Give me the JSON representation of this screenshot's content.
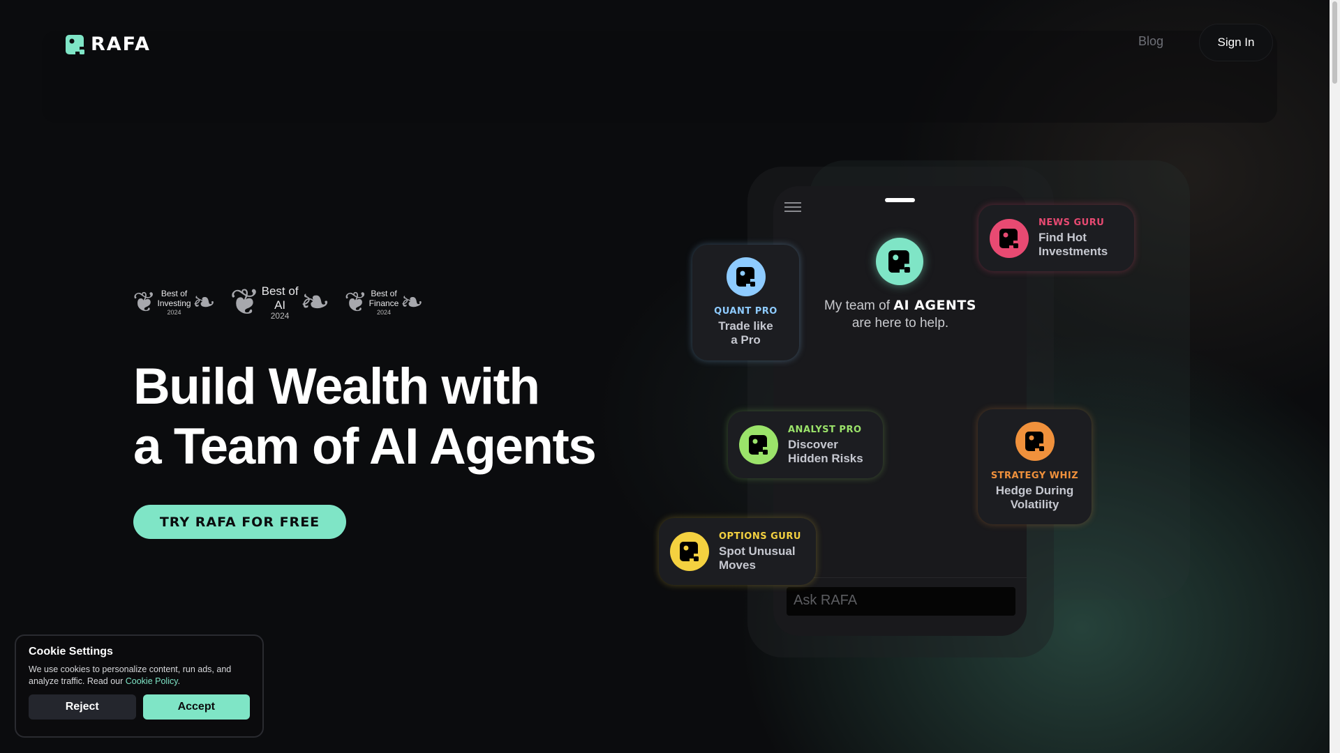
{
  "nav": {
    "brand": "RAFA",
    "blog": "Blog",
    "sign_in": "Sign In"
  },
  "colors": {
    "accent": "#7fe5c6",
    "background": "#0b0c0e"
  },
  "badges": [
    {
      "line1": "Best of",
      "line2": "Investing",
      "year": "2024"
    },
    {
      "line1": "Best of",
      "line2": "AI",
      "year": "2024"
    },
    {
      "line1": "Best of",
      "line2": "Finance",
      "year": "2024"
    }
  ],
  "hero": {
    "line1": "Build Wealth with",
    "line2": "a Team of AI Agents",
    "cta": "TRY RAFA FOR FREE"
  },
  "phone": {
    "intro_prefix": "My team of",
    "intro_bold": "AI AGENTS",
    "intro_suffix": "are here to help.",
    "ask_placeholder": "Ask RAFA"
  },
  "agents": [
    {
      "name": "QUANT PRO",
      "line1": "Trade like",
      "line2": "a Pro",
      "color": "#8ecbff"
    },
    {
      "name": "NEWS GURU",
      "line1": "Find Hot",
      "line2": "Investments",
      "color": "#e84a72"
    },
    {
      "name": "ANALYST PRO",
      "line1": "Discover",
      "line2": "Hidden Risks",
      "color": "#9be36a"
    },
    {
      "name": "STRATEGY WHIZ",
      "line1": "Hedge During",
      "line2": "Volatility",
      "color": "#f0913c"
    },
    {
      "name": "OPTIONS GURU",
      "line1": "Spot Unusual",
      "line2": "Moves",
      "color": "#f4d140"
    }
  ],
  "cookie": {
    "title": "Cookie Settings",
    "text": "We use cookies to personalize content, run ads, and analyze traffic. Read our",
    "link": "Cookie Policy",
    "period": ".",
    "reject": "Reject",
    "accept": "Accept"
  }
}
